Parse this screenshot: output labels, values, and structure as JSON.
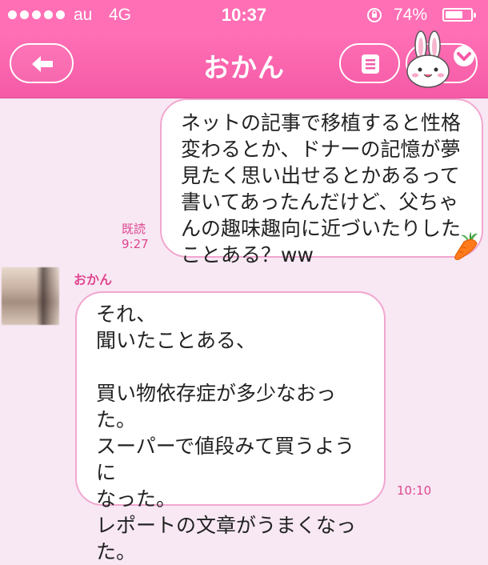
{
  "status_bar": {
    "carrier": "au",
    "network": "4G",
    "time": "10:37",
    "battery_percent": "74%",
    "battery_level": 0.74
  },
  "header": {
    "title": "おかん",
    "back_icon": "arrow-left-icon",
    "menu_icon": "list-menu-icon",
    "sticker_icon": "bunny-icon",
    "colors": {
      "bar": "#ff6fb5",
      "accent": "#e0478f"
    }
  },
  "messages": [
    {
      "direction": "sent",
      "text": "ネットの記事で移植すると性格\n変わるとか、ドナーの記憶が夢\n見たく思い出せるとかあるって\n書いてあったんだけど、父ちゃ\nんの趣味趣向に近づいたりした\nことある？ww",
      "read_label": "既読",
      "time": "9:27"
    },
    {
      "direction": "received",
      "sender": "おかん",
      "text": "それ、\n聞いたことある、\n\n買い物依存症が多少なおった。\nスーパーで値段みて買うように\nなった。\nレポートの文章がうまくなっ\nた。",
      "time": "10:10"
    }
  ]
}
